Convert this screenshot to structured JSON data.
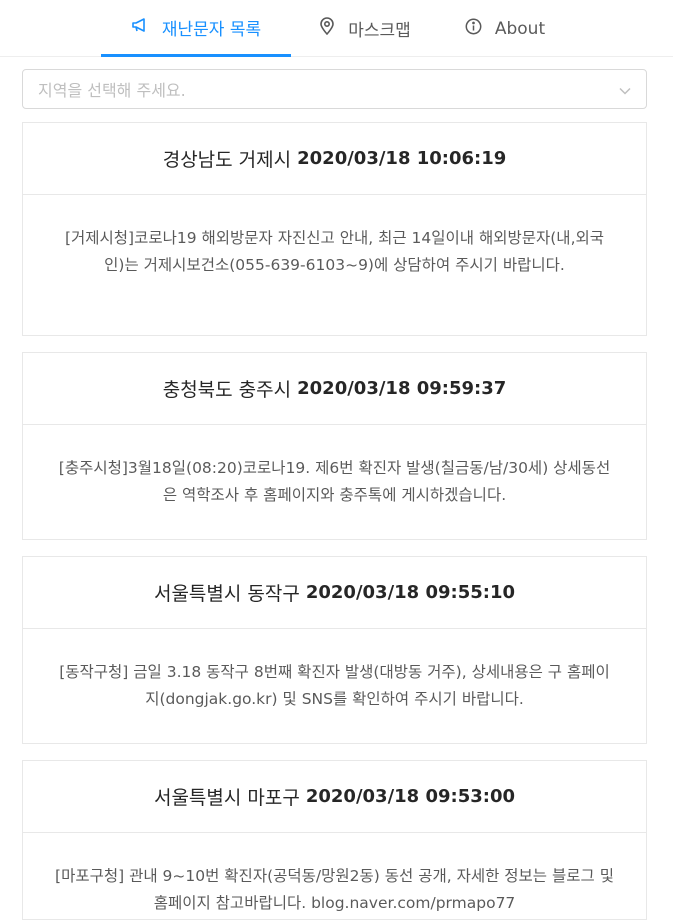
{
  "nav": {
    "tabs": [
      {
        "label": "재난문자 목록",
        "icon": "megaphone-icon",
        "active": true
      },
      {
        "label": "마스크맵",
        "icon": "location-pin-icon",
        "active": false
      },
      {
        "label": "About",
        "icon": "info-circle-icon",
        "active": false
      }
    ]
  },
  "region_select": {
    "placeholder": "지역을 선택해 주세요."
  },
  "messages": [
    {
      "region": "경상남도 거제시",
      "datetime": "2020/03/18 10:06:19",
      "text": "[거제시청]코로나19 해외방문자 자진신고 안내, 최근 14일이내 해외방문자(내,외국인)는 거제시보건소(055-639-6103~9)에 상담하여 주시기 바랍니다."
    },
    {
      "region": "충청북도 충주시",
      "datetime": "2020/03/18 09:59:37",
      "text": "[충주시청]3월18일(08:20)코로나19. 제6번 확진자 발생(칠금동/남/30세) 상세동선은 역학조사 후 홈페이지와 충주톡에 게시하겠습니다."
    },
    {
      "region": "서울특별시 동작구",
      "datetime": "2020/03/18 09:55:10",
      "text": "[동작구청] 금일 3.18 동작구 8번째 확진자 발생(대방동 거주), 상세내용은 구 홈페이지(dongjak.go.kr) 및 SNS를 확인하여 주시기 바랍니다."
    },
    {
      "region": "서울특별시 마포구",
      "datetime": "2020/03/18 09:53:00",
      "text": "[마포구청] 관내 9~10번 확진자(공덕동/망원2동) 동선 공개, 자세한 정보는 블로그 및 홈페이지 참고바랍니다. blog.naver.com/prmapo77"
    }
  ],
  "colors": {
    "accent": "#1890ff",
    "border": "#e8e8e8"
  }
}
